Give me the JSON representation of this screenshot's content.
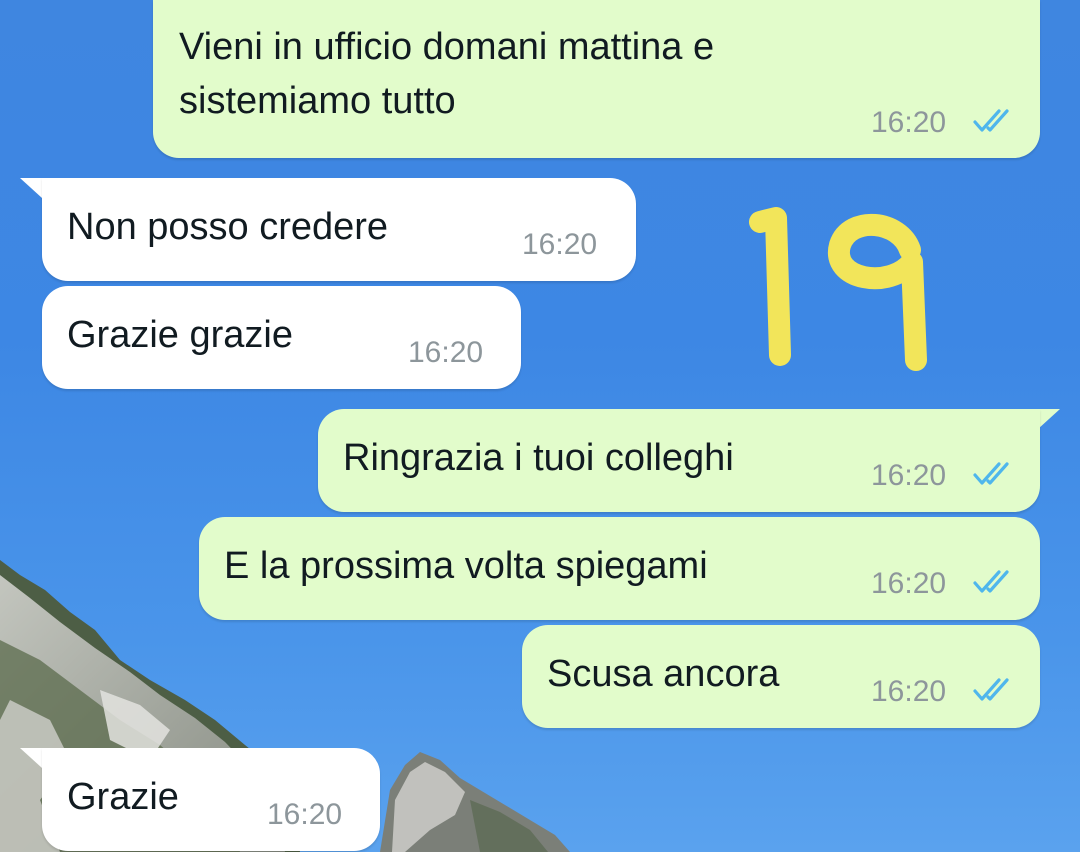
{
  "wallpaper": {
    "description_icon": "mountain-wallpaper"
  },
  "overlay_annotation": "19",
  "messages": [
    {
      "direction": "outgoing",
      "text": "Vieni in ufficio domani mattina e\nsistemiamo tutto",
      "time": "16:20",
      "status": "read"
    },
    {
      "direction": "incoming",
      "text": "Non posso credere",
      "time": "16:20"
    },
    {
      "direction": "incoming",
      "text": "Grazie grazie",
      "time": "16:20"
    },
    {
      "direction": "outgoing",
      "text": "Ringrazia i tuoi colleghi",
      "time": "16:20",
      "status": "read"
    },
    {
      "direction": "outgoing",
      "text": "E la prossima volta spiegami",
      "time": "16:20",
      "status": "read"
    },
    {
      "direction": "outgoing",
      "text": "Scusa ancora",
      "time": "16:20",
      "status": "read"
    },
    {
      "direction": "incoming",
      "text": "Grazie",
      "time": "16:20"
    }
  ],
  "colors": {
    "outgoing_bubble": "#e2fccb",
    "incoming_bubble": "#ffffff",
    "read_ticks": "#4fb6ec",
    "overlay": "#f2e55a",
    "sky": "#3f86e0"
  }
}
